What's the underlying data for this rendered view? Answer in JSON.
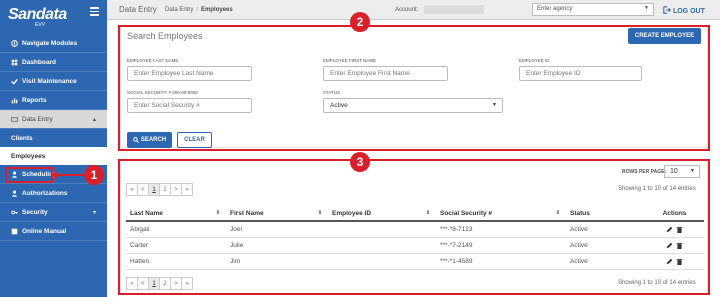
{
  "brand": {
    "name": "Sandata",
    "sub": "EVV"
  },
  "sidebar": {
    "items": [
      {
        "label": "Navigate Modules"
      },
      {
        "label": "Dashboard"
      },
      {
        "label": "Visit Maintenance"
      },
      {
        "label": "Reports"
      },
      {
        "label": "Data Entry"
      },
      {
        "label": "Clients"
      },
      {
        "label": "Employees"
      },
      {
        "label": "Scheduling"
      },
      {
        "label": "Authorizations"
      },
      {
        "label": "Security"
      },
      {
        "label": "Online Manual"
      }
    ]
  },
  "topbar": {
    "title": "Data Entry",
    "breadcrumb": [
      "Data Entry",
      "Employees"
    ],
    "account_label": "Account:",
    "agency_placeholder": "Enter agency",
    "logout": "LOG OUT"
  },
  "search": {
    "title": "Search Employees",
    "create_button": "CREATE EMPLOYEE",
    "last_name_label": "EMPLOYEE LAST NAME",
    "last_name_placeholder": "Enter Employee Last Name",
    "first_name_label": "EMPLOYEE FIRST NAME",
    "first_name_placeholder": "Enter Employee First Name",
    "id_label": "EMPLOYEE ID",
    "id_placeholder": "Enter Employee ID",
    "ssn_label": "SOCIAL SECURITY # 000-00-0000",
    "ssn_placeholder": "Enter Social Security #",
    "status_label": "STATUS",
    "status_value": "Active",
    "search_button": "SEARCH",
    "clear_button": "CLEAR"
  },
  "results": {
    "rows_per_page_label": "ROWS PER PAGE:",
    "rows_per_page": "10",
    "pager": [
      "«",
      "<",
      "1",
      "2",
      ">",
      "»"
    ],
    "showing": "Showing 1 to 10 of 14 entries",
    "columns": [
      "Last Name",
      "First Name",
      "Employee ID",
      "Social Security #",
      "Status",
      "Actions"
    ],
    "rows": [
      {
        "last": "Abigail",
        "first": "Joel",
        "id": "",
        "ssn": "***-*8-7123",
        "status": "Active"
      },
      {
        "last": "Carter",
        "first": "Julie",
        "id": "",
        "ssn": "***-*7-2149",
        "status": "Active"
      },
      {
        "last": "Hatten",
        "first": "Jim",
        "id": "",
        "ssn": "***-*1-4589",
        "status": "Active"
      }
    ]
  },
  "callouts": [
    "1",
    "2",
    "3"
  ],
  "colors": {
    "brand_blue": "#2e67b1",
    "callout_red": "#d9202a"
  }
}
